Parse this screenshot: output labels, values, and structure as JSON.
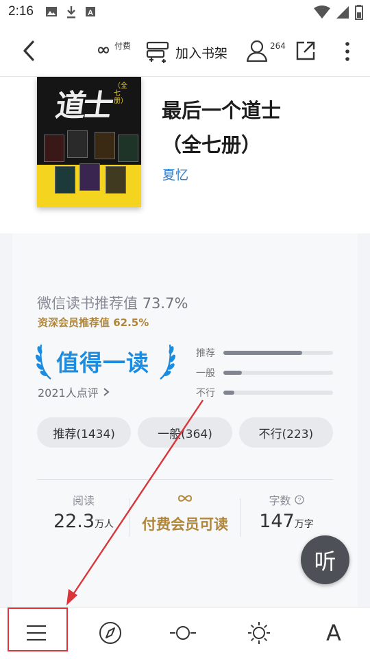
{
  "status_bar": {
    "time": "2:16",
    "left_icons": [
      "image-icon",
      "download-icon",
      "a-box-icon"
    ],
    "right_icons": [
      "wifi-icon",
      "signal-icon",
      "battery-icon"
    ]
  },
  "toolbar": {
    "back_icon": "chevron-left-icon",
    "paid_label": "付费",
    "add_shelf_label": "加入书架",
    "reviewers_count": "264",
    "share_icon": "share-icon",
    "more_icon": "more-vertical-icon"
  },
  "book": {
    "title_line1": "最后一个道士",
    "title_line2": "（全七册）",
    "author": "夏忆",
    "cover_title": "道士",
    "cover_subtitle": "（全七册）"
  },
  "rating": {
    "recommend_label": "微信读书推荐值",
    "recommend_value": "73.7%",
    "senior_label": "资深会员推荐值 62.5%",
    "badge_text": "值得一读",
    "reviews_link": "2021人点评",
    "bars": [
      {
        "label": "推荐",
        "fraction": 0.72
      },
      {
        "label": "一般",
        "fraction": 0.17
      },
      {
        "label": "不行",
        "fraction": 0.1
      }
    ],
    "filters": [
      "推荐(1434)",
      "一般(364)",
      "不行(223)"
    ]
  },
  "stats": {
    "read_label": "阅读",
    "read_value": "22.3",
    "read_unit": "万人",
    "member_value": "付费会员可读",
    "words_label": "字数",
    "words_value": "147",
    "words_unit": "万字"
  },
  "listen_label": "听",
  "bottom_bar": {
    "items": [
      "menu-icon",
      "compass-icon",
      "progress-icon",
      "brightness-icon",
      "font-icon"
    ],
    "font_label": "A"
  },
  "colors": {
    "accent_blue": "#1b8ce0",
    "gold": "#b0863a",
    "annotation_red": "#d9353a"
  }
}
